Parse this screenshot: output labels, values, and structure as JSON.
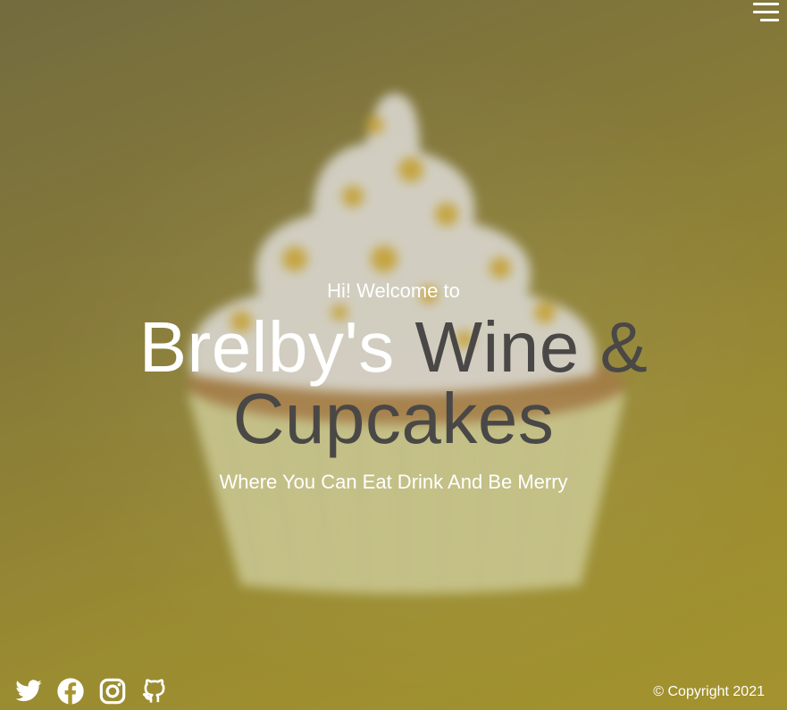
{
  "nav": {
    "menu_icon": "hamburger-menu-icon"
  },
  "hero": {
    "greeting": "Hi! Welcome to",
    "title_name": "Brelby's",
    "title_rest": "Wine & Cupcakes",
    "tagline": "Where You Can Eat Drink And Be Merry",
    "background": "blurred cupcake on yellow background"
  },
  "footer": {
    "social": [
      {
        "icon": "twitter-icon"
      },
      {
        "icon": "facebook-icon"
      },
      {
        "icon": "instagram-icon"
      },
      {
        "icon": "github-icon"
      }
    ],
    "copyright": "© Copyright 2021"
  },
  "colors": {
    "background": "#ad9b2f",
    "title_dark": "#4a4846",
    "text_light": "#ffffff"
  }
}
